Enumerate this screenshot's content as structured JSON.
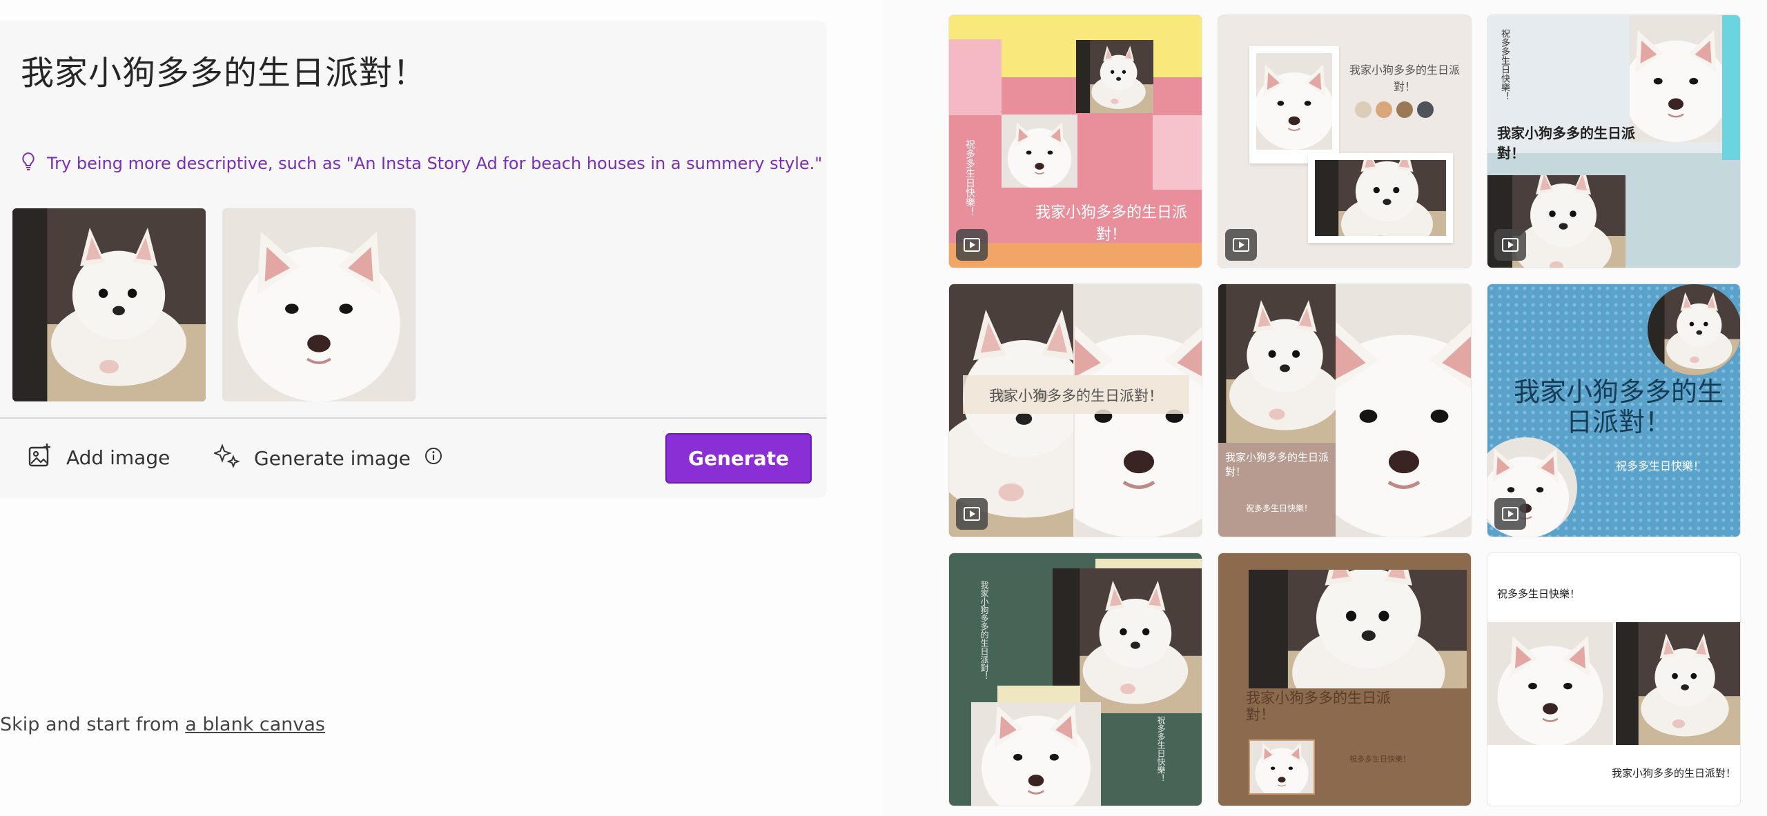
{
  "prompt": {
    "text": "我家小狗多多的生日派對！"
  },
  "hint": {
    "text": "Try being more descriptive, such as \"An Insta Story Ad for beach houses in a summery style.\""
  },
  "toolbar": {
    "add_image": "Add image",
    "generate_image": "Generate image",
    "generate": "Generate"
  },
  "skip": {
    "prefix": "Skip and start from ",
    "link": "a blank canvas"
  },
  "templates": [
    {
      "title": "我家小狗多多的生日派對！",
      "subtitle": "祝多多生日快樂！"
    },
    {
      "title": "我家小狗多多的生日派對！"
    },
    {
      "title": "我家小狗多多的生日派對！",
      "subtitle": "祝多多生日快樂！"
    },
    {
      "title": "我家小狗多多的生日派對！"
    },
    {
      "title": "我家小狗多多的生日派對！",
      "subtitle": "祝多多生日快樂！"
    },
    {
      "title": "我家小狗多多的生日派對！",
      "subtitle": "祝多多生日快樂！"
    },
    {
      "title": "我家小狗多多的生日派對！",
      "subtitle": "祝多多生日快樂！"
    },
    {
      "title": "我家小狗多多的生日派對！",
      "subtitle": "祝多多生日快樂！"
    },
    {
      "title": "我家小狗多多的生日派對！",
      "subtitle": "祝多多生日快樂！"
    }
  ],
  "colors": {
    "accent": "#8a2fd6",
    "hint_text": "#7a2fb3",
    "swatches": [
      "#dccdb8",
      "#d9a77a",
      "#9a7a55",
      "#4d5358"
    ]
  }
}
